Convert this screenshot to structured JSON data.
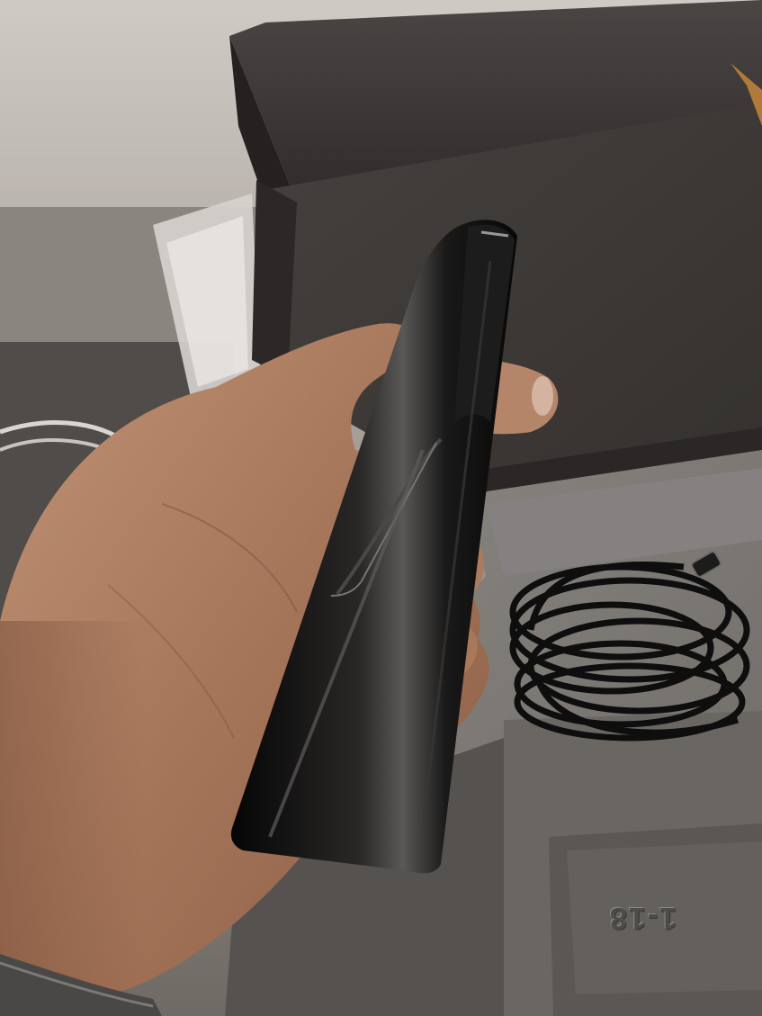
{
  "photo": {
    "embossed_text": "1-18"
  },
  "colors": {
    "phone_body": "#141212",
    "box_interior": "#3a3836",
    "foam_tray": "#7a7672",
    "skin": "#a8785a",
    "cable": "#101010"
  },
  "icons": [
    "phone",
    "hand",
    "usb-c-cable",
    "box",
    "foam-tray",
    "sleeve"
  ]
}
